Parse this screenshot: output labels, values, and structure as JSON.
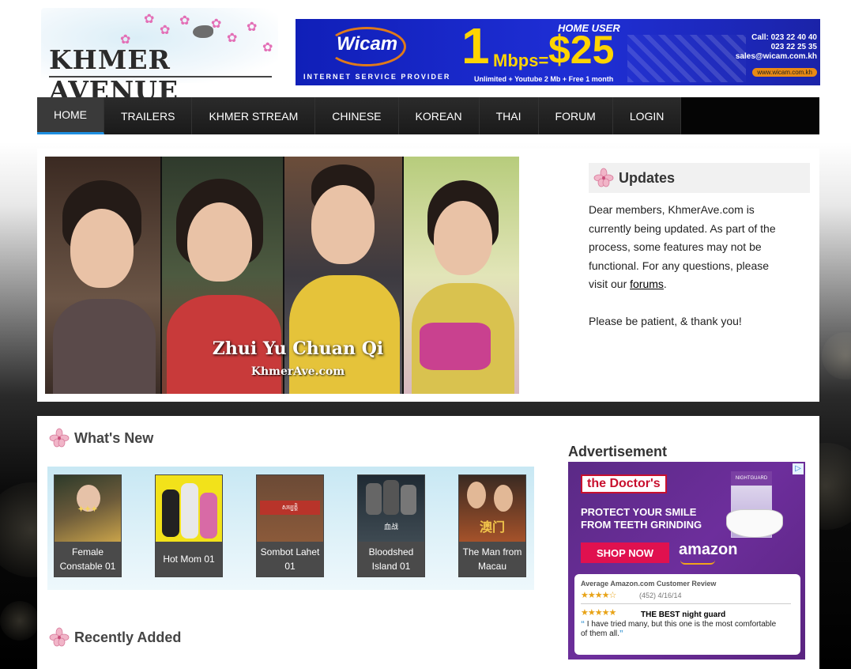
{
  "header": {
    "logo_text": "KHMER AVENUE",
    "banner": {
      "brand": "Wicam",
      "tagline": "INTERNET SERVICE PROVIDER",
      "speed_num": "1",
      "speed_unit": "Mbps=",
      "home_user": "HOME USER",
      "price": "$25",
      "offer": "Unlimited + Youtube 2 Mb + Free 1 month",
      "call": "Call: 023 22 40 40",
      "phone2": "023 22 25 35",
      "email": "sales@wicam.com.kh",
      "site": "www.wicam.com.kh"
    }
  },
  "nav": {
    "items": [
      {
        "label": "HOME",
        "active": true
      },
      {
        "label": "TRAILERS"
      },
      {
        "label": "KHMER STREAM"
      },
      {
        "label": "CHINESE"
      },
      {
        "label": "KOREAN"
      },
      {
        "label": "THAI"
      },
      {
        "label": "FORUM"
      },
      {
        "label": "LOGIN"
      }
    ]
  },
  "slider": {
    "title": "Zhui Yu Chuan Qi",
    "site": "KhmerAve.com"
  },
  "updates": {
    "title": "Updates",
    "text_before_link": "Dear members, KhmerAve.com is currently being updated. As part of the process, some features may not be functional. For any questions, please visit our ",
    "link": "forums",
    "text_after_link": ".",
    "thanks": "Please be patient, & thank you!"
  },
  "whats_new": {
    "title": "What's New",
    "items": [
      {
        "label": "Female Constable 01"
      },
      {
        "label": "Hot Mom 01"
      },
      {
        "label": "Sombot Lahet 01"
      },
      {
        "label": "Bloodshed Island 01"
      },
      {
        "label": "The Man from Macau"
      }
    ]
  },
  "recently_added": {
    "title": "Recently Added"
  },
  "advertisement": {
    "title": "Advertisement",
    "brand": "the Doctor's",
    "headline_1": "PROTECT YOUR SMILE",
    "headline_2": "FROM TEETH GRINDING",
    "cta": "SHOP NOW",
    "store": "amazon",
    "product_label": "NIGHTGUARD",
    "review_heading": "Average Amazon.com Customer Review",
    "review_count": "(452) 4/16/14",
    "review_title": "THE BEST night guard",
    "review_quote": "I have tried many, but this one is the most comfortable of them all.",
    "adchoices": "▷"
  },
  "colors": {
    "nav_active_underline": "#1e8fe0",
    "nav_bg": "#050505",
    "ad_purple": "#6d2e9c",
    "cta_pink": "#e0114f"
  }
}
